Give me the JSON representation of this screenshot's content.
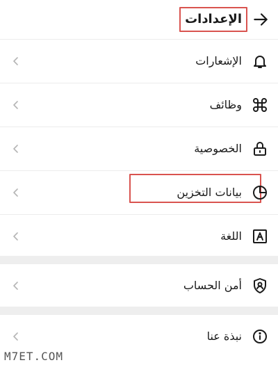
{
  "header": {
    "title": "الإعدادات",
    "back_icon": "arrow-right-icon"
  },
  "menu": {
    "items": [
      {
        "label": "الإشعارات",
        "icon": "bell-icon"
      },
      {
        "label": "وظائف",
        "icon": "command-icon"
      },
      {
        "label": "الخصوصية",
        "icon": "lock-icon"
      },
      {
        "label": "بيانات التخزين",
        "icon": "pie-chart-icon"
      },
      {
        "label": "اللغة",
        "icon": "language-icon"
      },
      {
        "label": "أمن الحساب",
        "icon": "shield-user-icon"
      },
      {
        "label": "نبذة عنا",
        "icon": "info-icon"
      }
    ]
  },
  "watermark": "M7ET.COM",
  "colors": {
    "highlight": "#d9534f",
    "section_gap": "#eeeeee",
    "chevron": "#b5b5b5"
  }
}
